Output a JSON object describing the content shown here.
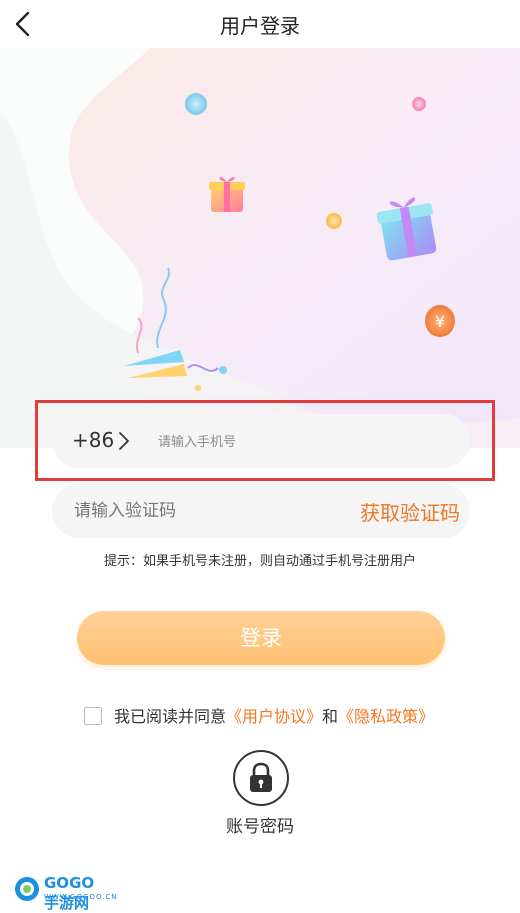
{
  "header": {
    "title": "用户登录",
    "back_icon": "chevron-left-icon"
  },
  "phone": {
    "country_code": "+86",
    "chevron_icon": "chevron-right-icon",
    "placeholder": "请输入手机号"
  },
  "verification": {
    "placeholder": "请输入验证码",
    "get_code_label": "获取验证码"
  },
  "hint": "提示：如果手机号未注册，则自动通过手机号注册用户",
  "login": {
    "label": "登录"
  },
  "agreement": {
    "prefix": "我已阅读并同意",
    "user_agreement": "《用户协议》",
    "and": "和",
    "privacy_policy": "《隐私政策》",
    "checked": false
  },
  "account_login": {
    "label": "账号密码",
    "icon": "lock-icon"
  },
  "logo": {
    "main_text": "GOGO手游网",
    "sub_text": "WWW.GOGOO.CN"
  },
  "colors": {
    "accent": "#f07722",
    "button_gradient": [
      "#ffd199",
      "#ffc070"
    ],
    "highlight_border": "#e23b3b",
    "input_bg": "#f5f5f5"
  }
}
